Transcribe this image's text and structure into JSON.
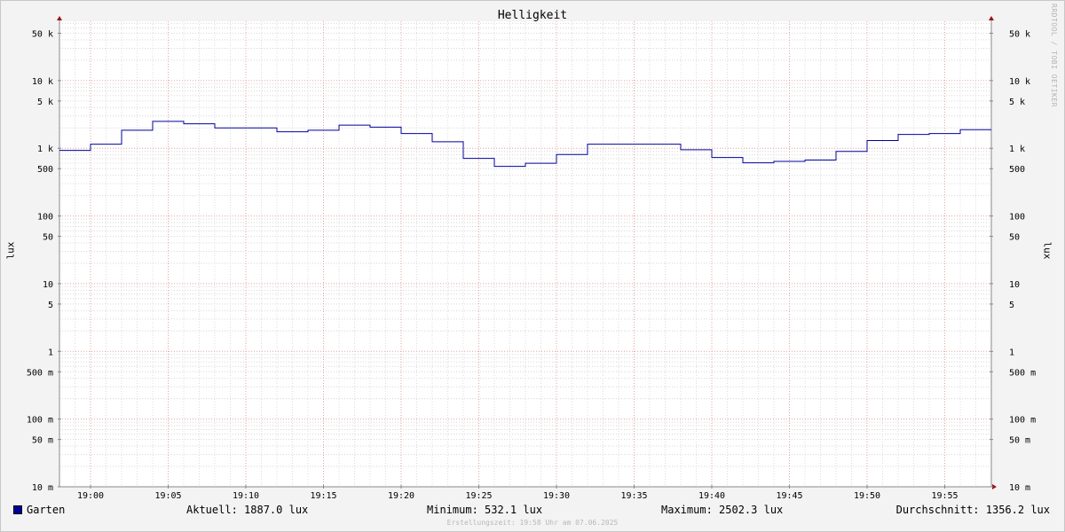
{
  "title": "Helligkeit",
  "watermark": "RRDTOOL / TOBI OETIKER",
  "chart_data": {
    "type": "line",
    "title": "Helligkeit",
    "xlabel": "",
    "ylabel": "lux",
    "yscale": "log",
    "ylim": [
      0.01,
      70000
    ],
    "xlim": [
      "18:58",
      "19:58"
    ],
    "grid": true,
    "x_ticks": [
      "19:00",
      "19:05",
      "19:10",
      "19:15",
      "19:20",
      "19:25",
      "19:30",
      "19:35",
      "19:40",
      "19:45",
      "19:50",
      "19:55"
    ],
    "y_ticks": [
      {
        "value": 50000,
        "label": "50 k"
      },
      {
        "value": 10000,
        "label": "10 k"
      },
      {
        "value": 5000,
        "label": "5 k"
      },
      {
        "value": 1000,
        "label": "1 k"
      },
      {
        "value": 500,
        "label": "500"
      },
      {
        "value": 100,
        "label": "100"
      },
      {
        "value": 50,
        "label": "50"
      },
      {
        "value": 10,
        "label": "10"
      },
      {
        "value": 5,
        "label": "5"
      },
      {
        "value": 1,
        "label": "1"
      },
      {
        "value": 0.5,
        "label": "500 m"
      },
      {
        "value": 0.1,
        "label": "100 m"
      },
      {
        "value": 0.05,
        "label": "50 m"
      },
      {
        "value": 0.01,
        "label": "10 m"
      }
    ],
    "series": [
      {
        "name": "Garten",
        "color": "#00009e",
        "step": true,
        "x": [
          "18:58",
          "19:00",
          "19:02",
          "19:04",
          "19:06",
          "19:08",
          "19:10",
          "19:12",
          "19:14",
          "19:16",
          "19:18",
          "19:20",
          "19:22",
          "19:24",
          "19:26",
          "19:28",
          "19:30",
          "19:32",
          "19:34",
          "19:36",
          "19:38",
          "19:40",
          "19:42",
          "19:44",
          "19:46",
          "19:48",
          "19:50",
          "19:52",
          "19:54",
          "19:56"
        ],
        "values": [
          930,
          1150,
          1850,
          2500,
          2300,
          2000,
          2000,
          1750,
          1850,
          2200,
          2050,
          1650,
          1250,
          710,
          540,
          600,
          810,
          1150,
          1150,
          1150,
          950,
          730,
          610,
          640,
          670,
          900,
          1300,
          1600,
          1650,
          1880
        ]
      }
    ]
  },
  "legend": {
    "series_name": "Garten",
    "color": "#00009e",
    "current": "Aktuell: 1887.0 lux",
    "minimum": "Minimum: 532.1 lux",
    "maximum": "Maximum: 2502.3 lux",
    "average": "Durchschnitt: 1356.2 lux"
  },
  "footer": "Erstellungszeit: 19:58 Uhr am 07.06.2025"
}
